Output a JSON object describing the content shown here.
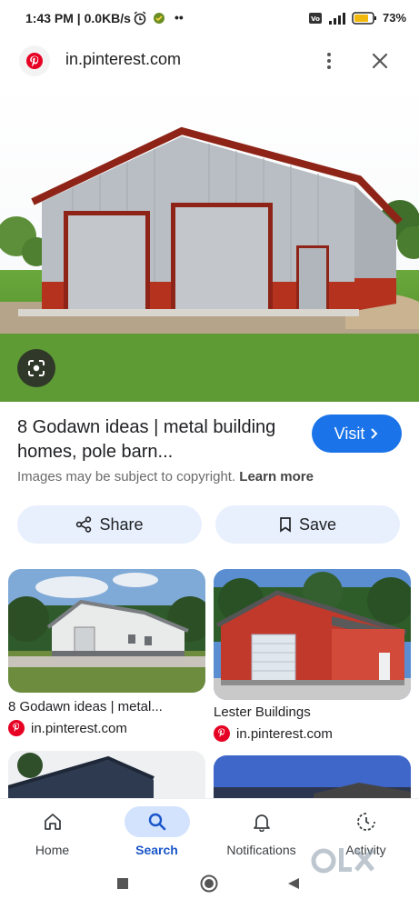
{
  "status_bar": {
    "time_net": "1:43 PM | 0.0KB/s",
    "battery": "73",
    "icons": [
      "alarm-icon",
      "app-notification-icon",
      "more-notifications-icon",
      "volte-icon",
      "signal-icon",
      "battery-icon"
    ]
  },
  "browser": {
    "url": "in.pinterest.com",
    "favicon": "pinterest-icon"
  },
  "result": {
    "title": "8 Godawn ideas | metal building homes, pole barn...",
    "visit_label": "Visit",
    "copyright": "Images may be subject to copyright.",
    "learn_more": "Learn more",
    "share_label": "Share",
    "save_label": "Save"
  },
  "related": [
    {
      "title": "8 Godawn ideas | metal...",
      "source": "in.pinterest.com"
    },
    {
      "title": "Lester Buildings",
      "source": "in.pinterest.com"
    }
  ],
  "bottom_nav": [
    {
      "label": "Home",
      "icon": "home-icon",
      "active": false
    },
    {
      "label": "Search",
      "icon": "search-icon",
      "active": true
    },
    {
      "label": "Notifications",
      "icon": "bell-icon",
      "active": false
    },
    {
      "label": "Activity",
      "icon": "activity-icon",
      "active": false
    }
  ],
  "colors": {
    "accent": "#1a73e8",
    "pill_bg": "#e8f0fe",
    "pinterest_red": "#e60023",
    "active_nav": "#1a56c9"
  },
  "watermark": "OLX"
}
